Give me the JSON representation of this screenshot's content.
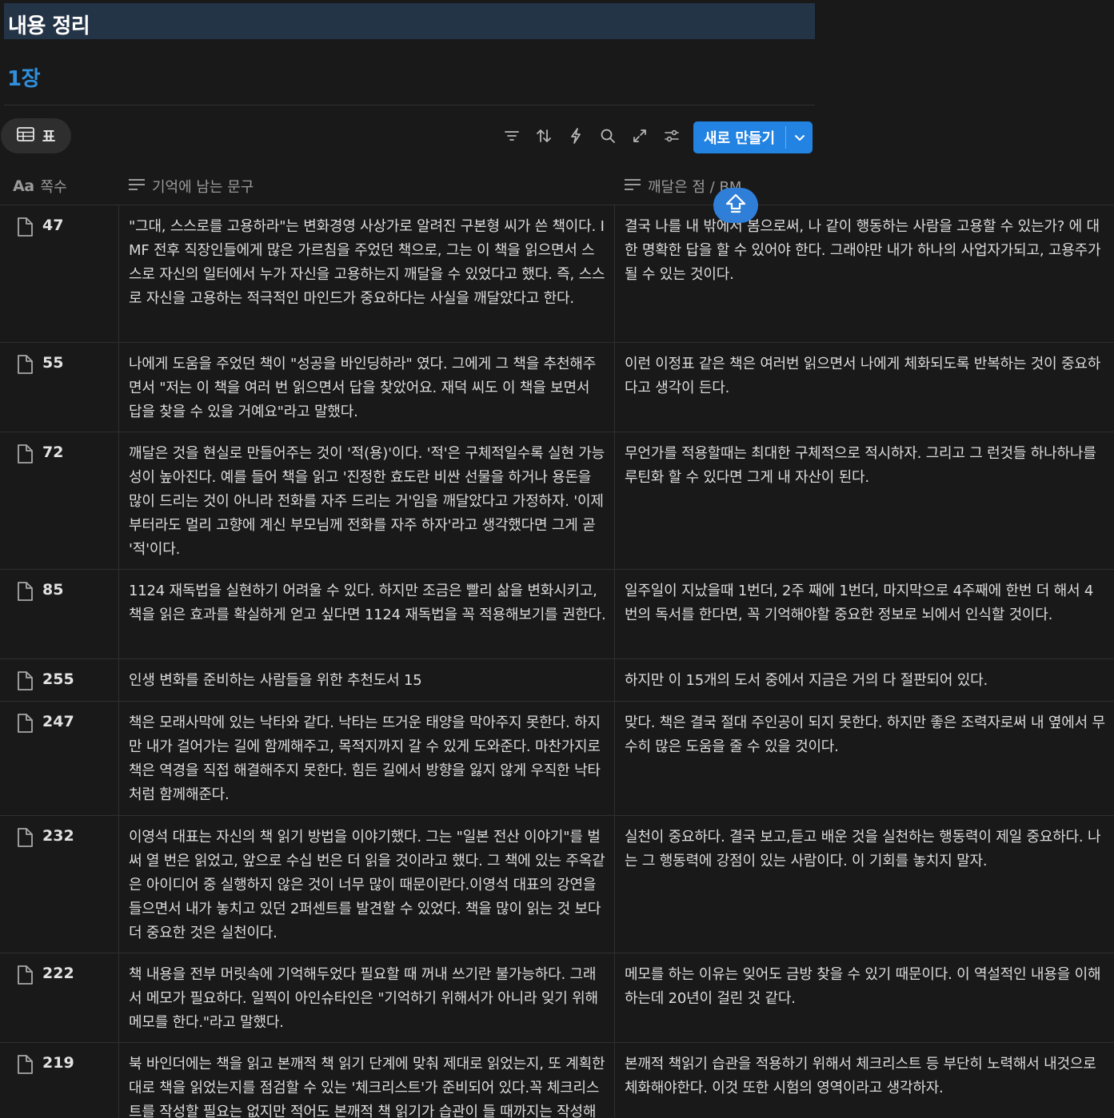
{
  "page": {
    "title": "내용 정리",
    "chapter": "1장"
  },
  "view_tab": {
    "icon": "table-icon",
    "label": "표"
  },
  "toolbar": {
    "tools": [
      "filter-icon",
      "sort-icon",
      "lightning-icon",
      "search-icon",
      "expand-icon",
      "settings-sliders-icon"
    ],
    "new_button": "새로 만들기"
  },
  "colors": {
    "background": "#191919",
    "title_bar": "#243447",
    "accent": "#2383e2",
    "chapter": "#2f8fdc"
  },
  "table": {
    "headers": {
      "page": "쪽수",
      "page_icon_text": "Aa",
      "quote": "기억에 남는 문구",
      "insight": "깨달은 점 / BM"
    },
    "rows": [
      {
        "page": "47",
        "quote": "\"그대, 스스로를 고용하라\"는 변화경영 사상가로 알려진 구본형 씨가 쓴 책이다. IMF 전후 직장인들에게 많은 가르침을 주었던 책으로, 그는 이 책을 읽으면서 스스로 자신의 일터에서 누가 자신을 고용하는지 깨달을 수 있었다고 했다. 즉, 스스로 자신을 고용하는 적극적인 마인드가 중요하다는 사실을 깨달았다고 한다.",
        "insight": "결국 나를 내 밖에서 봄으로써, 나 같이 행동하는 사람을 고용할 수 있는가? 에 대한 명확한 답을 할 수 있어야 한다. 그래야만 내가 하나의 사업자가되고, 고용주가 될 수 있는 것이다."
      },
      {
        "page": "55",
        "quote": "나에게 도움을 주었던 책이 \"성공을 바인딩하라\" 였다. 그에게 그 책을 추천해주면서 \"저는 이 책을 여러 번 읽으면서 답을 찾았어요. 재덕 씨도 이 책을 보면서 답을 찾을 수 있을 거예요\"라고 말했다.",
        "insight": "이런 이정표 같은 책은 여러번 읽으면서 나에게 체화되도록 반복하는 것이 중요하다고 생각이 든다."
      },
      {
        "page": "72",
        "quote": "깨달은 것을 현실로 만들어주는 것이 '적(용)'이다. '적'은 구체적일수록 실현 가능성이 높아진다. 예를 들어 책을 읽고 '진정한 효도란 비싼 선물을 하거나 용돈을 많이 드리는 것이 아니라 전화를 자주 드리는 거'임을 깨달았다고 가정하자. '이제부터라도 멀리 고향에 계신 부모님께 전화를 자주 하자'라고 생각했다면 그게 곧 '적'이다.",
        "insight": "무언가를 적용할때는 최대한 구체적으로 적시하자. 그리고 그 런것들 하나하나를 루틴화 할 수 있다면 그게 내 자산이 된다."
      },
      {
        "page": "85",
        "quote": "1124 재독법을 실현하기 어려울 수 있다. 하지만 조금은 빨리 삶을 변화시키고, 책을 읽은 효과를 확실하게 얻고 싶다면 1124 재독법을 꼭 적용해보기를 권한다.",
        "insight": "일주일이 지났을때 1번더, 2주 째에 1번더, 마지막으로 4주째에 한번 더 해서 4번의 독서를 한다면, 꼭 기억해야할 중요한 정보로 뇌에서 인식할 것이다."
      },
      {
        "page": "255",
        "quote": "인생 변화를 준비하는 사람들을 위한 추천도서 15",
        "insight": "하지만 이 15개의 도서 중에서 지금은 거의 다 절판되어 있다."
      },
      {
        "page": "247",
        "quote": "책은 모래사막에 있는 낙타와 같다. 낙타는 뜨거운 태양을 막아주지 못한다. 하지만 내가 걸어가는 길에 함께해주고, 목적지까지 갈 수 있게 도와준다. 마찬가지로 책은 역경을 직접 해결해주지 못한다. 힘든 길에서 방향을 잃지 않게 우직한 낙타처럼 함께해준다.",
        "insight": "맞다. 책은 결국 절대 주인공이 되지 못한다. 하지만 좋은 조력자로써 내 옆에서 무수히 많은 도움을 줄 수 있을 것이다."
      },
      {
        "page": "232",
        "quote": "이영석 대표는 자신의 책 읽기 방법을 이야기했다. 그는 \"일본 전산 이야기\"를 벌써 열 번은 읽었고, 앞으로 수십 번은 더 읽을 것이라고 했다. 그 책에 있는 주옥같은 아이디어 중 실행하지 않은 것이 너무 많이 때문이란다.이영석 대표의 강연을 들으면서 내가 놓치고 있던 2퍼센트를 발견할 수 있었다. 책을 많이 읽는 것 보다 더 중요한 것은 실천이다.",
        "insight": "실천이 중요하다. 결국 보고,듣고 배운 것을 실천하는 행동력이 제일 중요하다. 나는 그 행동력에 강점이 있는 사람이다. 이 기회를 놓치지 말자."
      },
      {
        "page": "222",
        "quote": "책 내용을 전부 머릿속에 기억해두었다 필요할 때 꺼내 쓰기란 불가능하다. 그래서 메모가 필요하다. 일찍이 아인슈타인은 \"기억하기 위해서가 아니라 잊기 위해 메모를 한다.\"라고 말했다.",
        "insight": "메모를 하는 이유는 잊어도 금방 찾을 수 있기 때문이다. 이 역설적인 내용을 이해하는데 20년이 걸린 것 같다."
      },
      {
        "page": "219",
        "quote": "북 바인더에는 책을 읽고 본깨적 책 읽기 단계에 맞춰 제대로 읽었는지, 또 계획한 대로 책을 읽었는지를 점검할 수 있는 '체크리스트'가 준비되어 있다.꼭 체크리스트를 작성할 필요는 없지만 적어도 본깨적 책 읽기가 습관이 들 때까지는 작성해보자.",
        "insight": "본깨적 책읽기 습관을 적용하기 위해서 체크리스트 등 부단히 노력해서 내것으로 체화해야한다. 이것 또한 시험의 영역이라고 생각하자."
      }
    ]
  }
}
